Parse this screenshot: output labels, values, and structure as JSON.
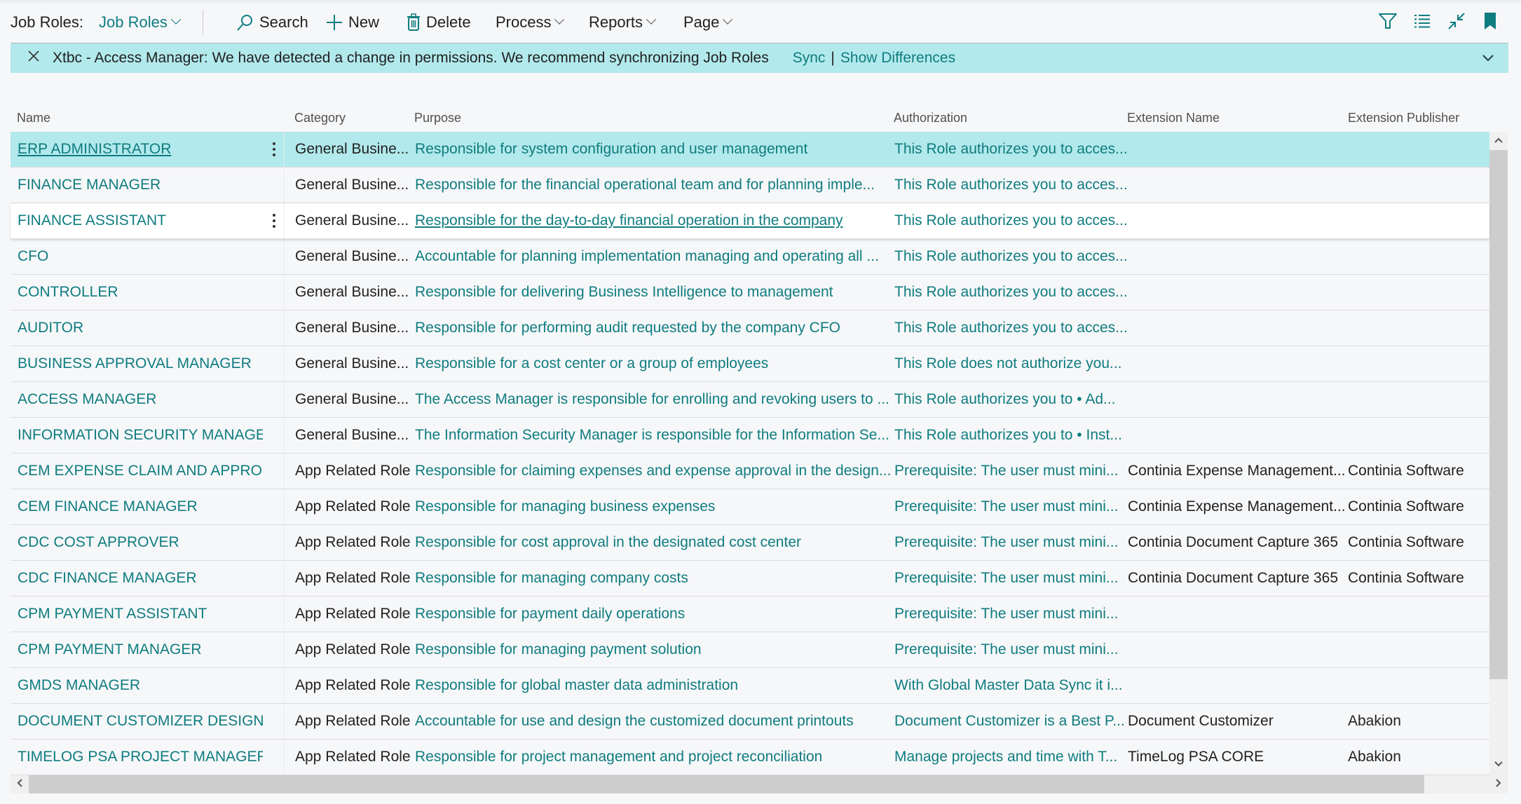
{
  "toolbar": {
    "title_label": "Job Roles:",
    "view_selector": "Job Roles",
    "actions": [
      {
        "id": "search",
        "label": "Search",
        "icon": "search-icon"
      },
      {
        "id": "new",
        "label": "New",
        "icon": "plus-icon"
      },
      {
        "id": "delete",
        "label": "Delete",
        "icon": "trash-icon"
      },
      {
        "id": "process",
        "label": "Process",
        "dropdown": true
      },
      {
        "id": "reports",
        "label": "Reports",
        "dropdown": true
      },
      {
        "id": "page",
        "label": "Page",
        "dropdown": true
      }
    ],
    "right_icons": [
      "filter-icon",
      "list-view-icon",
      "collapse-icon",
      "bookmark-icon"
    ]
  },
  "banner": {
    "message": "Xtbc - Access Manager: We have detected a change in permissions. We recommend synchronizing Job Roles",
    "sync_label": "Sync",
    "separator": "|",
    "show_differences_label": "Show Differences"
  },
  "colors": {
    "accent": "#0f7c7f",
    "banner_bg": "#b2e9ec",
    "selected_row_bg": "#b2e9ec",
    "page_bg": "#f6f7f9"
  },
  "table": {
    "columns": [
      "Name",
      "Category",
      "Purpose",
      "Authorization",
      "Extension Name",
      "Extension Publisher"
    ],
    "rows": [
      {
        "name": "ERP ADMINISTRATOR",
        "category": "General Busine...",
        "purpose": "Responsible for system configuration and user management",
        "authorization": "This Role authorizes you to acces...",
        "extension_name": "",
        "extension_publisher": "",
        "state": "selected"
      },
      {
        "name": "FINANCE MANAGER",
        "category": "General Busine...",
        "purpose": "Responsible for the financial operational team and for planning imple...",
        "authorization": "This Role authorizes you to acces...",
        "extension_name": "",
        "extension_publisher": ""
      },
      {
        "name": "FINANCE ASSISTANT",
        "category": "General Busine...",
        "purpose": "Responsible for the day-to-day financial operation in the company",
        "authorization": "This Role authorizes you to acces...",
        "extension_name": "",
        "extension_publisher": "",
        "state": "focused"
      },
      {
        "name": "CFO",
        "category": "General Busine...",
        "purpose": "Accountable for planning implementation managing and operating all ...",
        "authorization": "This Role authorizes you to acces...",
        "extension_name": "",
        "extension_publisher": ""
      },
      {
        "name": "CONTROLLER",
        "category": "General Busine...",
        "purpose": "Responsible for delivering Business Intelligence to management",
        "authorization": "This Role authorizes you to acces...",
        "extension_name": "",
        "extension_publisher": ""
      },
      {
        "name": "AUDITOR",
        "category": "General Busine...",
        "purpose": "Responsible for performing audit requested by the company CFO",
        "authorization": "This Role authorizes you to acces...",
        "extension_name": "",
        "extension_publisher": ""
      },
      {
        "name": "BUSINESS APPROVAL MANAGER",
        "category": "General Busine...",
        "purpose": "Responsible for a cost center or a group of employees",
        "authorization": "This Role does not authorize you...",
        "extension_name": "",
        "extension_publisher": ""
      },
      {
        "name": "ACCESS MANAGER",
        "category": "General Busine...",
        "purpose": "The Access Manager is responsible for enrolling and revoking users to ...",
        "authorization": "This Role authorizes you to • Ad...",
        "extension_name": "",
        "extension_publisher": ""
      },
      {
        "name": "INFORMATION SECURITY MANAGER",
        "category": "General Busine...",
        "purpose": "The Information Security Manager is responsible for the Information Se...",
        "authorization": "This Role authorizes you to • Inst...",
        "extension_name": "",
        "extension_publisher": ""
      },
      {
        "name": "CEM EXPENSE CLAIM AND APPRO...",
        "category": "App Related Role",
        "purpose": "Responsible for claiming expenses and expense approval in the design...",
        "authorization": "Prerequisite: The user must mini...",
        "extension_name": "Continia Expense Management...",
        "extension_publisher": "Continia Software"
      },
      {
        "name": "CEM FINANCE MANAGER",
        "category": "App Related Role",
        "purpose": "Responsible for managing business expenses",
        "authorization": "Prerequisite: The user must mini...",
        "extension_name": "Continia Expense Management...",
        "extension_publisher": "Continia Software"
      },
      {
        "name": "CDC COST APPROVER",
        "category": "App Related Role",
        "purpose": "Responsible for cost approval in the designated cost center",
        "authorization": "Prerequisite: The user must mini...",
        "extension_name": "Continia Document Capture 365",
        "extension_publisher": "Continia Software"
      },
      {
        "name": "CDC FINANCE MANAGER",
        "category": "App Related Role",
        "purpose": "Responsible for managing company costs",
        "authorization": "Prerequisite: The user must mini...",
        "extension_name": "Continia Document Capture 365",
        "extension_publisher": "Continia Software"
      },
      {
        "name": "CPM PAYMENT ASSISTANT",
        "category": "App Related Role",
        "purpose": "Responsible for payment daily operations",
        "authorization": "Prerequisite: The user must mini...",
        "extension_name": "",
        "extension_publisher": ""
      },
      {
        "name": "CPM PAYMENT MANAGER",
        "category": "App Related Role",
        "purpose": "Responsible for managing payment solution",
        "authorization": "Prerequisite: The user must mini...",
        "extension_name": "",
        "extension_publisher": ""
      },
      {
        "name": "GMDS MANAGER",
        "category": "App Related Role",
        "purpose": "Responsible for global master data administration",
        "authorization": "With Global Master Data Sync it i...",
        "extension_name": "",
        "extension_publisher": ""
      },
      {
        "name": "DOCUMENT CUSTOMIZER DESIGN...",
        "category": "App Related Role",
        "purpose": "Accountable for use and design the customized document printouts",
        "authorization": "Document Customizer is a Best P...",
        "extension_name": "Document Customizer",
        "extension_publisher": "Abakion"
      },
      {
        "name": "TIMELOG PSA PROJECT MANAGER",
        "category": "App Related Role",
        "purpose": "Responsible for project management and project reconciliation",
        "authorization": "Manage projects and time with T...",
        "extension_name": "TimeLog PSA CORE",
        "extension_publisher": "Abakion"
      }
    ]
  }
}
